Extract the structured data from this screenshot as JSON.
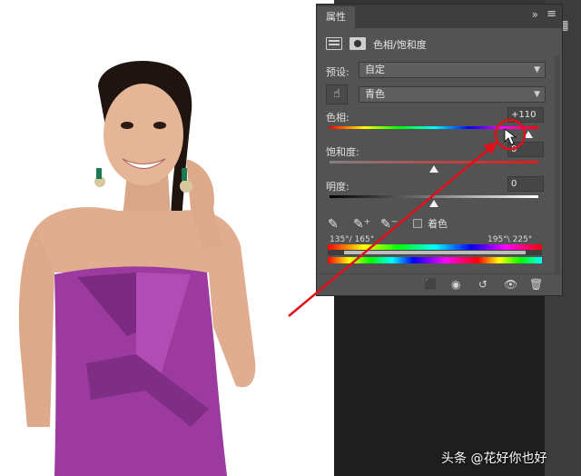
{
  "panel": {
    "tab_label": "属性",
    "adjustment_title": "色相/饱和度",
    "preset_label": "预设:",
    "preset_value": "自定",
    "channel_value": "青色",
    "hue_label": "色相:",
    "hue_value": "+110",
    "saturation_label": "饱和度:",
    "saturation_value": "0",
    "lightness_label": "明度:",
    "lightness_value": "0",
    "colorize_label": "着色",
    "range_left": "135°/ 165°",
    "range_right": "195°\\ 225°",
    "hue_slider_position": 0.95,
    "saturation_slider_position": 0.5,
    "lightness_slider_position": 0.5
  },
  "watermark": "头条 @花好你也好",
  "colors": {
    "panel_bg": "#535353",
    "annotation_red": "#e0101a",
    "dress": "#9c3aa0"
  },
  "icons": [
    "hand-icon",
    "eyedropper-icon",
    "eyedropper-plus-icon",
    "eyedropper-minus-icon",
    "clip-icon",
    "visibility-toggle-icon",
    "reset-icon",
    "eye-icon",
    "trash-icon",
    "collapse-icon",
    "menu-icon"
  ]
}
